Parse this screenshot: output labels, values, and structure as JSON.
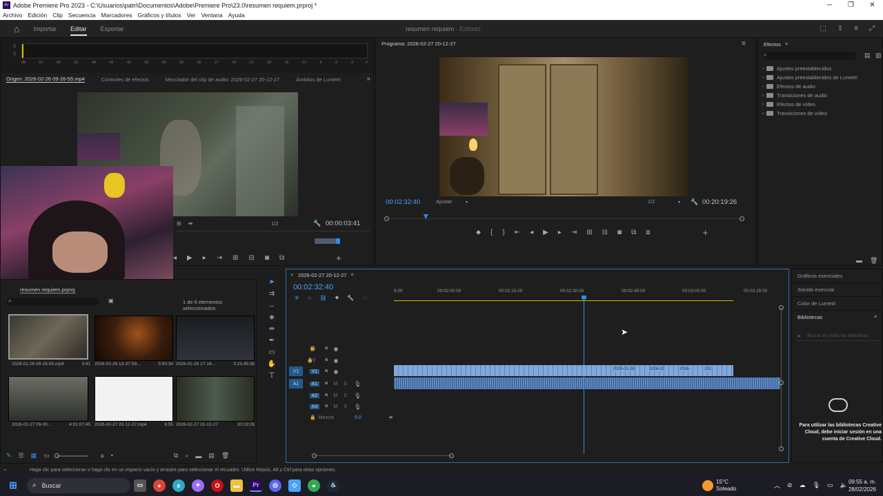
{
  "window": {
    "title": "Adobe Premiere Pro 2023 - C:\\Usuarios\\patri\\Documentos\\Adobe\\Premiere Pro\\23.0\\resumen requiem.prproj *",
    "app_badge": "Pr"
  },
  "menu": [
    "Archivo",
    "Edición",
    "Clip",
    "Secuencia",
    "Marcadores",
    "Gráficos y títulos",
    "Ver",
    "Ventana",
    "Ayuda"
  ],
  "header": {
    "tabs": [
      "Importar",
      "Editar",
      "Exportar"
    ],
    "active_tab": "Editar",
    "project_name": "resumen requiem",
    "project_status": "Editado"
  },
  "audio_meter": {
    "channels": [
      "S",
      "S"
    ],
    "scale": [
      "dB",
      "-57",
      "-54",
      "-51",
      "-48",
      "-45",
      "-42",
      "-39",
      "-36",
      "-33",
      "-30",
      "-27",
      "-24",
      "-21",
      "-18",
      "-15",
      "-12",
      "-9",
      "-6",
      "-3",
      "0"
    ]
  },
  "source_panel": {
    "tabs": [
      "Origen: 2026-02-26 09-26-55.mp4",
      "Controles de efectos",
      "Mezclador del clip de audio: 2026-02-27 20-12-27",
      "Ámbitos de Lumetri"
    ],
    "resolution": "1/2",
    "timecode": "00:00:03:41"
  },
  "program_panel": {
    "title": "Programa: 2026-02-27 20-12-27",
    "timecode": "00:02:32:40",
    "fit": "Ajustar",
    "resolution": "1/2",
    "duration": "00:20:19:26",
    "playhead_pct": 11
  },
  "effects_panel": {
    "title": "Efectos",
    "items": [
      "Ajustes preestablecidos",
      "Ajustes preestablecidos de Lumetri",
      "Efectos de audio",
      "Transiciones de audio",
      "Efectos de vídeo",
      "Transiciones de vídeo"
    ]
  },
  "project_panel": {
    "title": "resumen requiem.prproj",
    "selection_info": "1 de 6 elementos seleccionados",
    "items": [
      {
        "name": "2026-02-26 09-26-55.mp4",
        "duration": "3:41"
      },
      {
        "name": "2026-02-26 13-37-59...",
        "duration": "5:50:34"
      },
      {
        "name": "2026-02-26 17-16-...",
        "duration": "3:23:45:36"
      },
      {
        "name": "2026-02-27 09-00...",
        "duration": "4:01:07:45"
      },
      {
        "name": "2026-02-27 20-12-27.mp4",
        "duration": "6:55"
      },
      {
        "name": "2026-02-27 20-12-27",
        "duration": "20:19:26"
      }
    ]
  },
  "timeline": {
    "sequence_name": "2026-02-27 20-12-27",
    "timecode": "00:02:32:40",
    "ruler": [
      "5:00",
      "00:02:00:00",
      "00:02:15:00",
      "00:02:30:00",
      "00:02:45:00",
      "00:03:00:00",
      "00:03:15:00"
    ],
    "video_tracks": [
      "V3",
      "V2",
      "V1"
    ],
    "audio_tracks": [
      "A1",
      "A2",
      "A3"
    ],
    "source_patch": {
      "video": "V1",
      "audio": "A1"
    },
    "mute_label": "M",
    "solo_label": "S",
    "mix_label": "Mezcla",
    "mix_value": "0.0",
    "clip_labels": [
      "2026-02-26",
      "2026-02",
      "2026-",
      "202"
    ]
  },
  "right_panels": {
    "items": [
      "Gráficos esenciales",
      "Sonido esencial",
      "Color de Lumetri",
      "Bibliotecas"
    ],
    "search_placeholder": "Buscar en todas las bibliotecas",
    "cc_message": "Para utilizar las bibliotecas Creative Cloud, debe iniciar sesión en una cuenta de Creative Cloud."
  },
  "status_bar": {
    "message": "Haga clic para seleccionar o haga clic en un espacio vacío y arrastre para seleccionar el recuadro. Utilice Mayús, Alt y Ctrl para otras opciones."
  },
  "taskbar": {
    "search_label": "Buscar",
    "weather_temp": "15°C",
    "weather_desc": "Soleado",
    "time": "09:55 a. m.",
    "date": "28/02/2026"
  }
}
